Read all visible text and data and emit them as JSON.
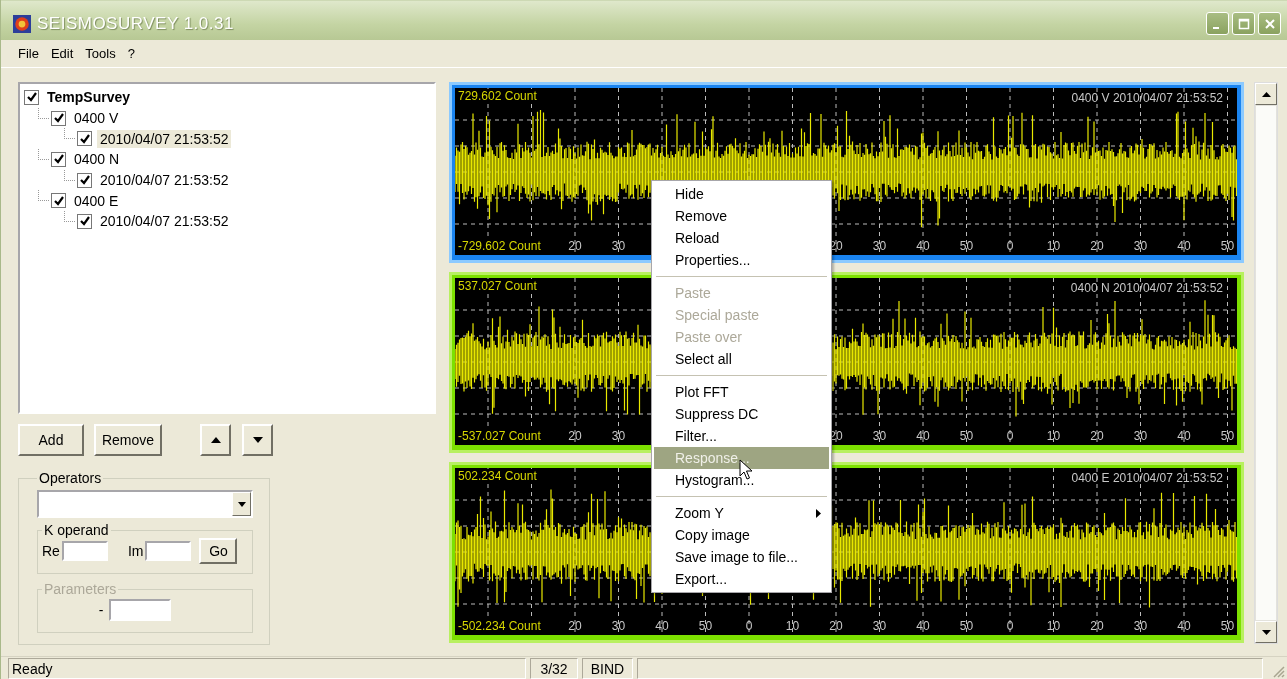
{
  "window": {
    "title": "SEISMOSURVEY 1.0.31"
  },
  "menu_bar": [
    "File",
    "Edit",
    "Tools",
    "?"
  ],
  "tree": [
    {
      "label": "TempSurvey",
      "checked": true,
      "selected": false,
      "children": [
        {
          "label": "0400 V",
          "checked": true,
          "selected": false,
          "children": [
            {
              "label": "2010/04/07 21:53:52",
              "checked": true,
              "selected": true
            }
          ]
        },
        {
          "label": "0400 N",
          "checked": true,
          "selected": false,
          "children": [
            {
              "label": "2010/04/07 21:53:52",
              "checked": true,
              "selected": false
            }
          ]
        },
        {
          "label": "0400 E",
          "checked": true,
          "selected": false,
          "children": [
            {
              "label": "2010/04/07 21:53:52",
              "checked": true,
              "selected": false
            }
          ]
        }
      ]
    }
  ],
  "list_buttons": [
    {
      "kind": "text",
      "label": "Add"
    },
    {
      "kind": "text",
      "label": "Remove"
    },
    {
      "kind": "up"
    },
    {
      "kind": "down"
    }
  ],
  "operators": {
    "legend": "Operators",
    "k_operand": {
      "legend": "K operand",
      "fields": [
        {
          "label": "Re"
        },
        {
          "label": "Im"
        }
      ],
      "button": "Go"
    },
    "parameters": {
      "legend": "Parameters",
      "disabled": true,
      "fields": [
        {
          "label": "-"
        }
      ]
    }
  },
  "plots": [
    {
      "max_label": "729.602 Count",
      "min_label": "-729.602 Count",
      "title": "0400 V 2010/04/07 21:53:52",
      "selected": true,
      "x_tick_groups": [
        [
          "20",
          "30"
        ],
        [
          "20",
          "30",
          "40",
          "50",
          "0",
          "10",
          "20",
          "30",
          "40",
          "50"
        ]
      ]
    },
    {
      "max_label": "537.027 Count",
      "min_label": "-537.027 Count",
      "title": "0400 N 2010/04/07 21:53:52",
      "selected": false,
      "x_tick_groups": [
        [
          "20",
          "30"
        ],
        [
          "20",
          "30",
          "40",
          "50",
          "0",
          "10",
          "20",
          "30",
          "40",
          "50"
        ]
      ]
    },
    {
      "max_label": "502.234 Count",
      "min_label": "-502.234 Count",
      "title": "0400 E 2010/04/07 21:53:52",
      "selected": false,
      "x_tick_groups": [
        [
          "20",
          "30",
          "40",
          "50",
          "0",
          "10",
          "20",
          "30",
          "40",
          "50",
          "0",
          "10",
          "20",
          "30",
          "40",
          "50"
        ]
      ]
    }
  ],
  "context_menu": [
    {
      "kind": "item",
      "label": "Hide",
      "disabled": false,
      "selected": false
    },
    {
      "kind": "item",
      "label": "Remove",
      "disabled": false,
      "selected": false
    },
    {
      "kind": "item",
      "label": "Reload",
      "disabled": false,
      "selected": false
    },
    {
      "kind": "item",
      "label": "Properties...",
      "disabled": false,
      "selected": false
    },
    {
      "kind": "separator"
    },
    {
      "kind": "item",
      "label": "Paste",
      "disabled": true,
      "selected": false
    },
    {
      "kind": "item",
      "label": "Special paste",
      "disabled": true,
      "selected": false
    },
    {
      "kind": "item",
      "label": "Paste over",
      "disabled": true,
      "selected": false
    },
    {
      "kind": "item",
      "label": "Select all",
      "disabled": false,
      "selected": false
    },
    {
      "kind": "separator"
    },
    {
      "kind": "item",
      "label": "Plot FFT",
      "disabled": false,
      "selected": false
    },
    {
      "kind": "item",
      "label": "Suppress DC",
      "disabled": false,
      "selected": false
    },
    {
      "kind": "item",
      "label": "Filter...",
      "disabled": false,
      "selected": false
    },
    {
      "kind": "item",
      "label": "Response...",
      "disabled": false,
      "selected": true
    },
    {
      "kind": "item",
      "label": "Hystogram...",
      "disabled": false,
      "selected": false
    },
    {
      "kind": "separator"
    },
    {
      "kind": "submenu",
      "label": "Zoom Y",
      "disabled": false,
      "selected": false
    },
    {
      "kind": "item",
      "label": "Copy image",
      "disabled": false,
      "selected": false
    },
    {
      "kind": "item",
      "label": "Save image to file...",
      "disabled": false,
      "selected": false
    },
    {
      "kind": "item",
      "label": "Export...",
      "disabled": false,
      "selected": false
    }
  ],
  "status_bar": [
    "Ready",
    "3/32",
    "BIND"
  ]
}
